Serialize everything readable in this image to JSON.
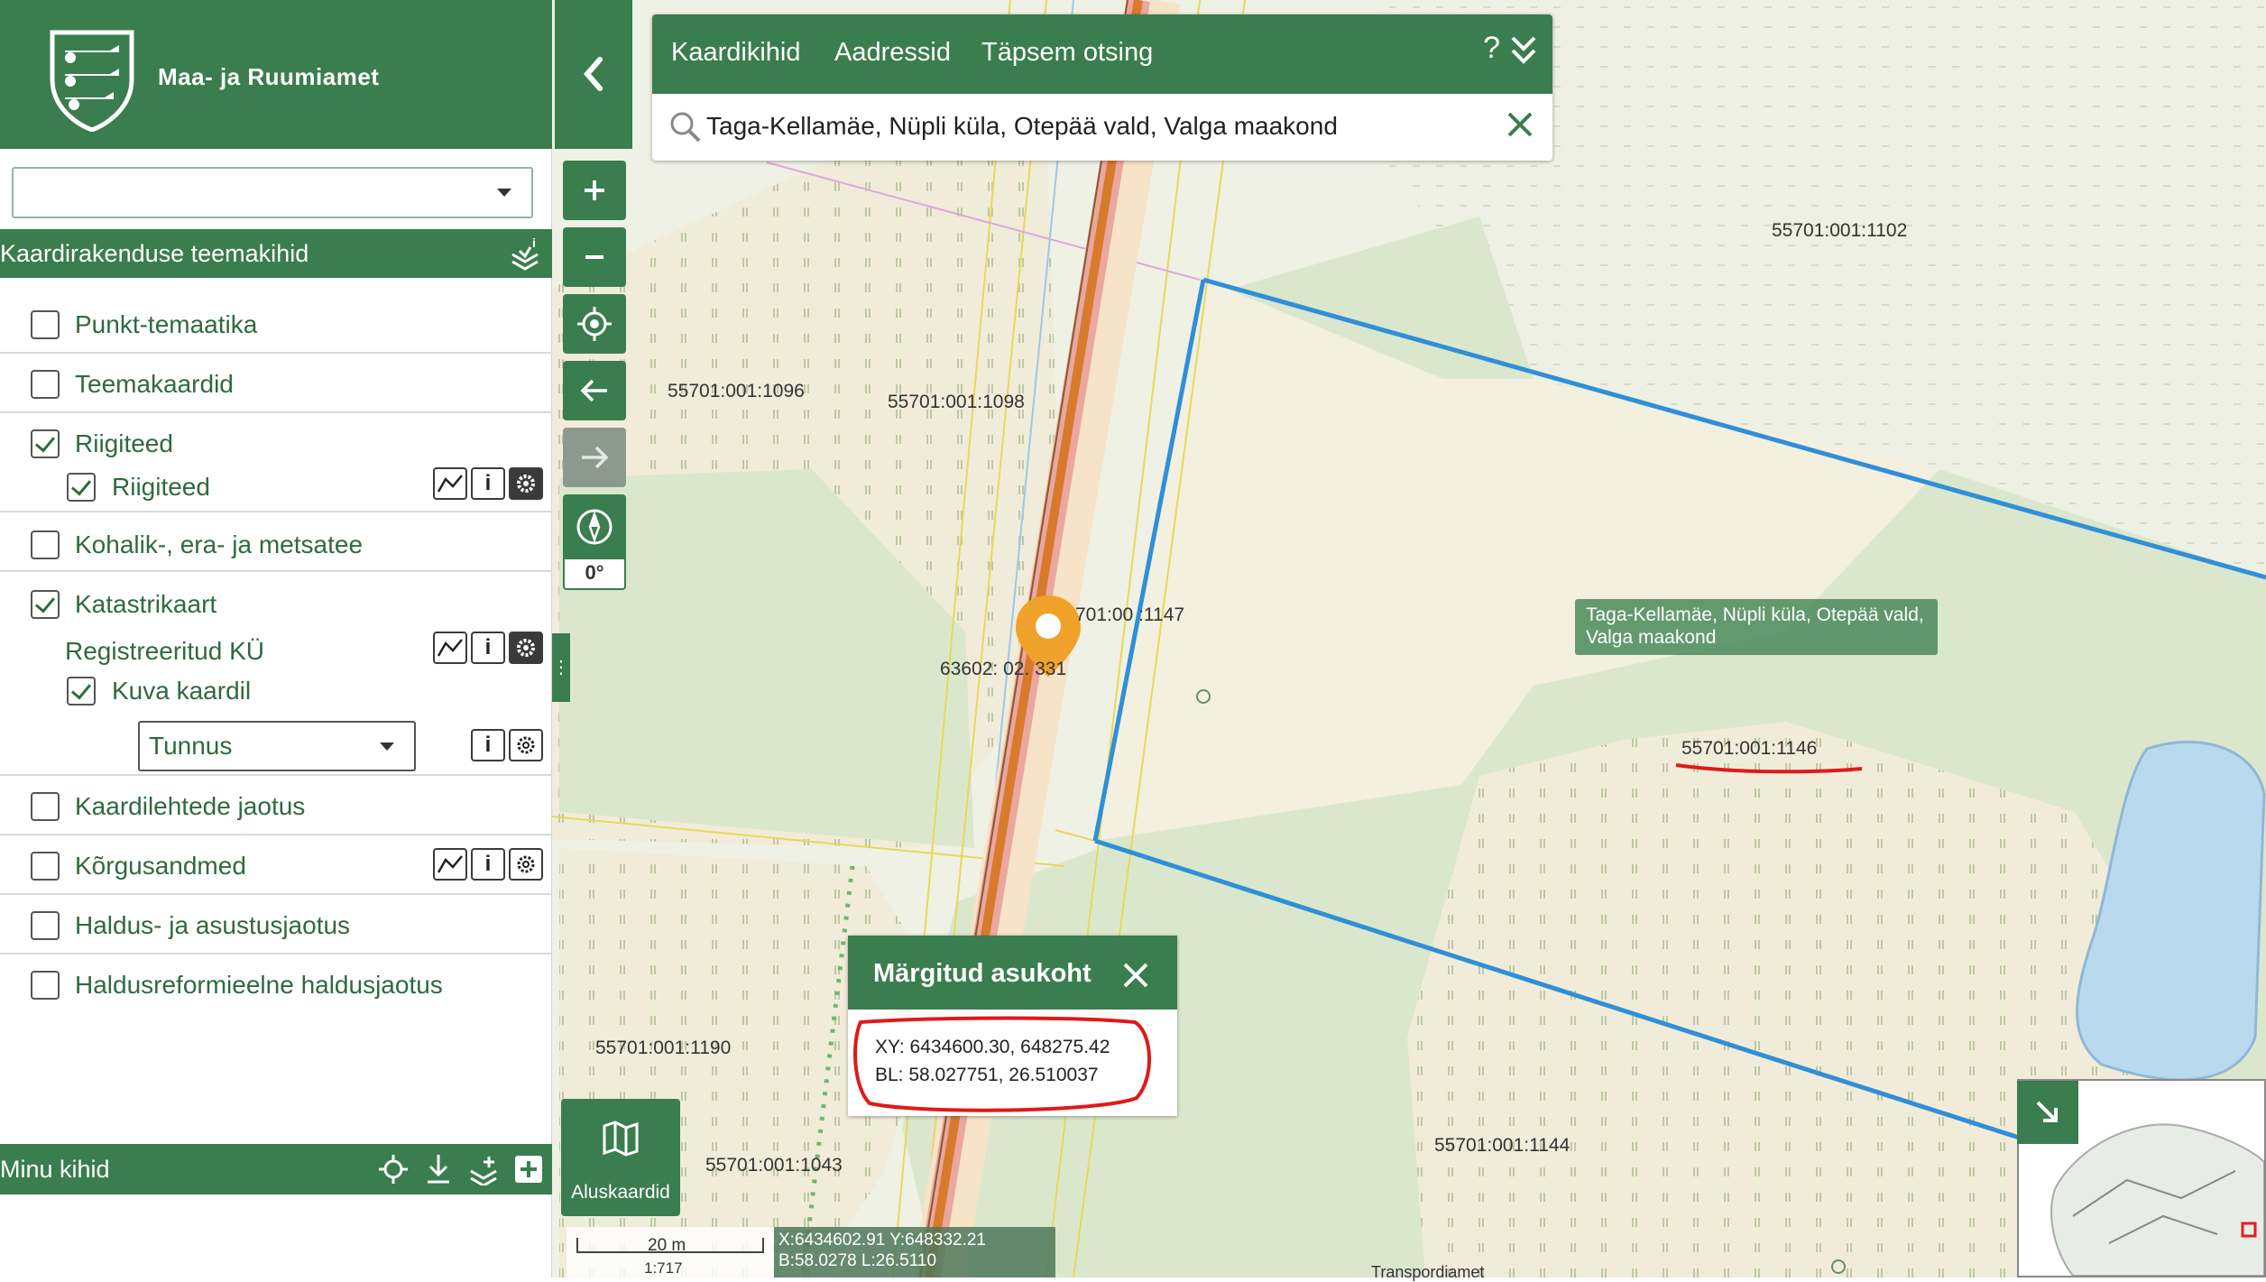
{
  "app": {
    "logo_text": "Maa- ja Ruumiamet"
  },
  "panel": {
    "theme_header": "Kaardirakenduse teemakihid",
    "layers": [
      {
        "label": "Punkt-temaatika",
        "checked": false
      },
      {
        "label": "Teemakaardid",
        "checked": false
      },
      {
        "label": "Riigiteed",
        "checked": true
      },
      {
        "label": "Riigiteed",
        "checked": true
      },
      {
        "label": "Kohalik-, era- ja metsatee",
        "checked": false
      },
      {
        "label": "Katastrikaart",
        "checked": true
      },
      {
        "label": "Registreeritud KÜ"
      },
      {
        "label": "Kuva kaardil",
        "checked": true
      },
      {
        "label": "Kaardilehtede jaotus",
        "checked": false
      },
      {
        "label": "Kõrgusandmed",
        "checked": false
      },
      {
        "label": "Haldus- ja asustusjaotus",
        "checked": false
      },
      {
        "label": "Haldusreformieelne haldusjaotus",
        "checked": false
      }
    ],
    "tunnus_select": "Tunnus",
    "my_layers": "Minu kihid",
    "info_glyph": "i"
  },
  "search": {
    "tabs": [
      "Kaardikihid",
      "Aadressid",
      "Täpsem otsing"
    ],
    "help": "?",
    "value": "Taga-Kellamäe, Nüpli küla, Otepää vald, Valga maakond"
  },
  "controls": {
    "rotation": "0°"
  },
  "popup": {
    "title": "Märgitud asukoht",
    "xy": "XY: 6434600.30, 648275.42",
    "bl": "BL: 58.027751, 26.510037"
  },
  "tooltip": {
    "address": "Taga-Kellamäe, Nüpli küla, Otepää vald, Valga maakond"
  },
  "basemap": {
    "label": "Aluskaardid"
  },
  "scale": {
    "distance": "20 m",
    "ratio": "1:717"
  },
  "cursor_coords": {
    "xy": "X:6434602.91 Y:648332.21",
    "bl": "B:58.0278 L:26.5110"
  },
  "map_labels": {
    "p1102": "55701:001:1102",
    "p1096": "55701:001:1096",
    "p1098": "55701:001:1098",
    "p1147": "701:00 :1147",
    "p63602": "63602: 02. 331",
    "p1146": "55701:001:1146",
    "p1190": "55701:001:1190",
    "p1043": "55701:001:1043",
    "p1144": "55701:001:1144",
    "bottom_text": "Transpordiamet"
  },
  "colors": {
    "brand_green": "#3a7d4e",
    "parcel_outline": "#2f8fd8",
    "annotation_red": "#e01919",
    "marker_orange": "#f0a22a"
  },
  "icons": [
    "chevron-left-icon",
    "zoom-in-icon",
    "zoom-out-icon",
    "locate-icon",
    "back-icon",
    "forward-icon",
    "compass-icon",
    "search-icon",
    "close-icon",
    "double-chevron-down-icon",
    "layers-info-icon",
    "map-icon",
    "expand-icon",
    "profile-icon",
    "info-icon",
    "gear-icon"
  ]
}
